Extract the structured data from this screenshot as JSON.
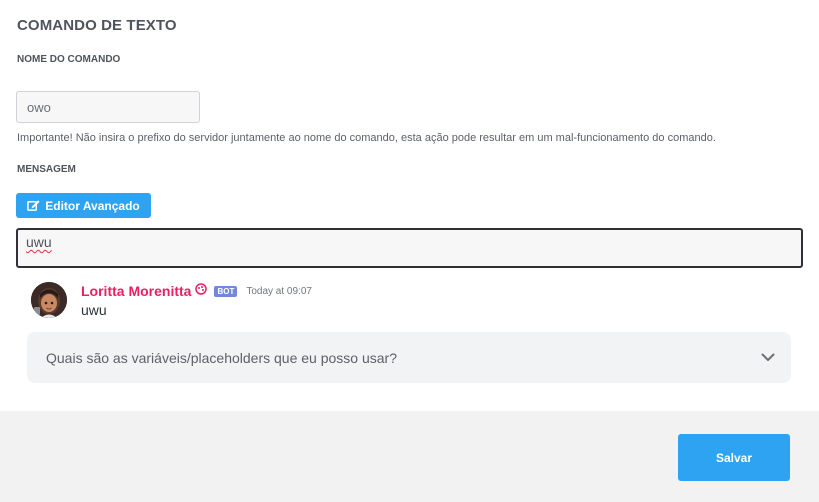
{
  "title": "COMANDO DE TEXTO",
  "command_name": {
    "label": "NOME DO COMANDO",
    "value": "owo",
    "hint": "Importante! Não insira o prefixo do servidor juntamente ao nome do comando, esta ação pode resultar em um mal-funcionamento do comando."
  },
  "message": {
    "label": "MENSAGEM",
    "editor_button": "Editor Avançado",
    "editor_icon": "edit-icon",
    "value": "uwu"
  },
  "preview": {
    "author": "Loritta Morenitta",
    "author_color": "#e91e63",
    "badge_icon": "palette-icon",
    "bot_tag": "BOT",
    "timestamp": "Today at 09:07",
    "content": "uwu"
  },
  "faq": {
    "question": "Quais são as variáveis/placeholders que eu posso usar?",
    "icon": "chevron-down-icon"
  },
  "footer": {
    "save_label": "Salvar"
  },
  "colors": {
    "accent": "#2ea3f2",
    "bot_badge": "#7289da"
  }
}
